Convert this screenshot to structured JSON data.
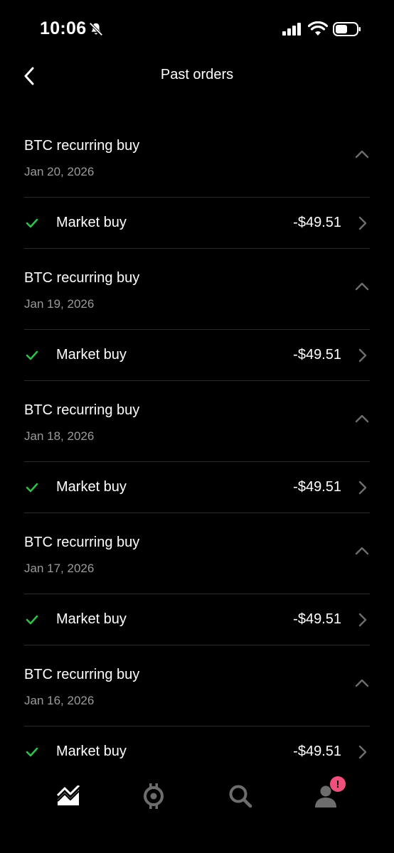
{
  "status_bar": {
    "time": "10:06"
  },
  "header": {
    "title": "Past orders"
  },
  "colors": {
    "check": "#2fbf4a",
    "badge": "#f0507c",
    "muted": "#9a9a9a",
    "icon_gray": "#6d6d6d"
  },
  "orders": [
    {
      "title": "BTC recurring buy",
      "date": "Jan 20, 2026",
      "order_label": "Market buy",
      "amount": "-$49.51"
    },
    {
      "title": "BTC recurring buy",
      "date": "Jan 19, 2026",
      "order_label": "Market buy",
      "amount": "-$49.51"
    },
    {
      "title": "BTC recurring buy",
      "date": "Jan 18, 2026",
      "order_label": "Market buy",
      "amount": "-$49.51"
    },
    {
      "title": "BTC recurring buy",
      "date": "Jan 17, 2026",
      "order_label": "Market buy",
      "amount": "-$49.51"
    },
    {
      "title": "BTC recurring buy",
      "date": "Jan 16, 2026",
      "order_label": "Market buy",
      "amount": "-$49.51"
    }
  ],
  "tabbar": {
    "tabs": [
      {
        "icon": "chart-icon",
        "active": true
      },
      {
        "icon": "crypto-icon",
        "active": false
      },
      {
        "icon": "search-icon",
        "active": false
      },
      {
        "icon": "profile-icon",
        "active": false,
        "badge": "!"
      }
    ]
  }
}
